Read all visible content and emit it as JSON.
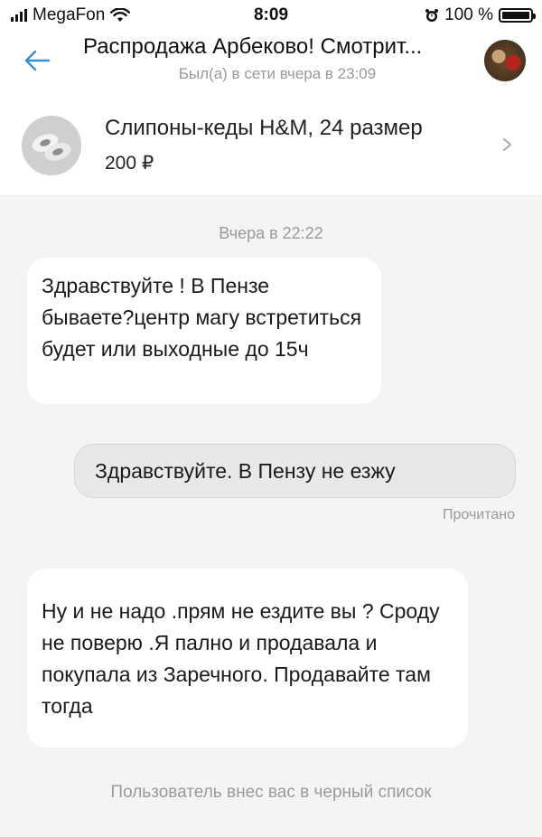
{
  "status_bar": {
    "carrier": "MegaFon",
    "time": "8:09",
    "battery": "100 %"
  },
  "header": {
    "title": "Распродажа Арбеково! Смотрит...",
    "subtitle": "Был(а) в сети вчера в 23:09"
  },
  "item": {
    "title": "Слипоны-кеды H&M, 24 размер",
    "price": "200 ₽"
  },
  "chat": {
    "date": "Вчера в 22:22",
    "messages": [
      {
        "direction": "incoming",
        "text": "Здравствуйте ! В Пензе бываете?центр магу встретиться будет или выходные до 15ч"
      },
      {
        "direction": "outgoing",
        "text": "Здравствуйте. В Пензу не езжу"
      },
      {
        "direction": "incoming",
        "text": "Ну и не надо .прям не ездите вы ? Сроду не поверю .Я пално и продавала и покупала из Заречного. Продавайте там тогда"
      }
    ],
    "read_status": "Прочитано",
    "system_notice": "Пользователь внес вас в черный список"
  },
  "colors": {
    "accent": "#3a8fcf",
    "muted_text": "#9a9a9e",
    "background": "#f4f4f5",
    "incoming_bubble": "#ffffff",
    "outgoing_bubble": "#e8e8ea"
  },
  "icons": {
    "back": "arrow-left-icon",
    "chevron": "chevron-right-icon",
    "wifi": "wifi-icon",
    "alarm": "alarm-icon",
    "battery": "battery-icon",
    "signal": "signal-bars-icon"
  }
}
